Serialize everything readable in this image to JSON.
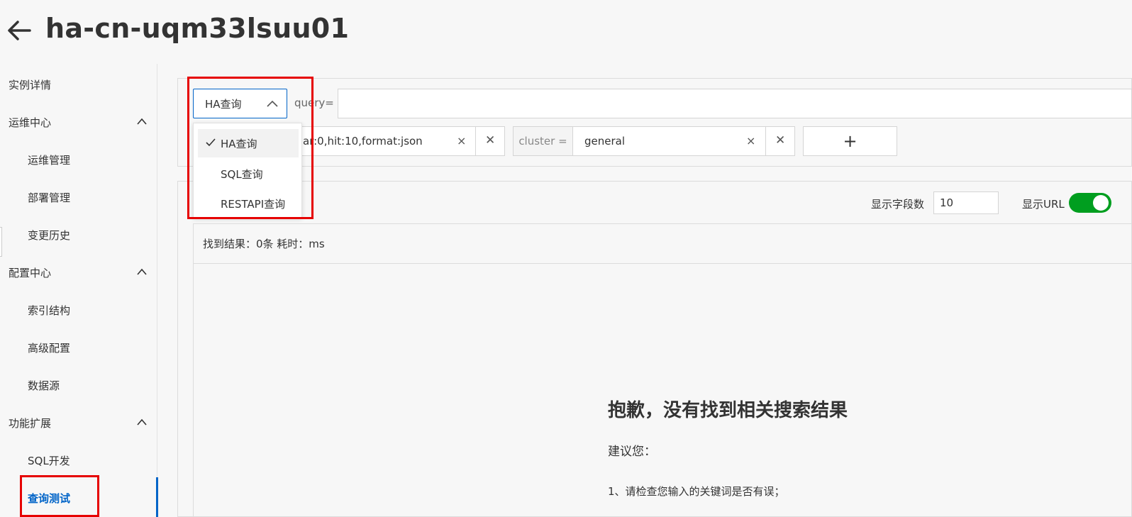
{
  "header": {
    "title": "ha-cn-uqm33lsuu01"
  },
  "sidebar": {
    "items": [
      {
        "label": "实例详情",
        "level": "top"
      },
      {
        "label": "运维中心",
        "level": "top",
        "expanded": true
      },
      {
        "label": "运维管理",
        "level": "sub"
      },
      {
        "label": "部署管理",
        "level": "sub"
      },
      {
        "label": "变更历史",
        "level": "sub"
      },
      {
        "label": "配置中心",
        "level": "top",
        "expanded": true
      },
      {
        "label": "索引结构",
        "level": "sub"
      },
      {
        "label": "高级配置",
        "level": "sub"
      },
      {
        "label": "数据源",
        "level": "sub"
      },
      {
        "label": "功能扩展",
        "level": "top",
        "expanded": true
      },
      {
        "label": "SQL开发",
        "level": "sub"
      },
      {
        "label": "查询测试",
        "level": "sub",
        "active": true
      }
    ]
  },
  "query": {
    "mode_selected": "HA查询",
    "query_label": "query=",
    "query_value": "",
    "config_tag_value": "ar:0,hit:10,format:json",
    "cluster_prefix": "cluster =",
    "cluster_value": "general",
    "close_glyph": "×",
    "remove_glyph": "✕",
    "add_label": "+"
  },
  "dropdown": {
    "options": [
      {
        "label": "HA查询",
        "selected": true
      },
      {
        "label": "SQL查询",
        "selected": false
      },
      {
        "label": "RESTAPI查询",
        "selected": false
      }
    ]
  },
  "results": {
    "field_count_label": "显示字段数",
    "field_count_value": "10",
    "show_url_label": "显示URL",
    "show_url_on": true,
    "summary": "找到结果：0条  耗时：ms",
    "empty_title": "抱歉，没有找到相关搜索结果",
    "empty_suggest": "建议您：",
    "empty_tip": "1、请检查您输入的关键词是否有误；"
  },
  "colors": {
    "accent": "#0064c8",
    "highlight_red": "#e60000",
    "toggle_on": "#009e1f"
  }
}
